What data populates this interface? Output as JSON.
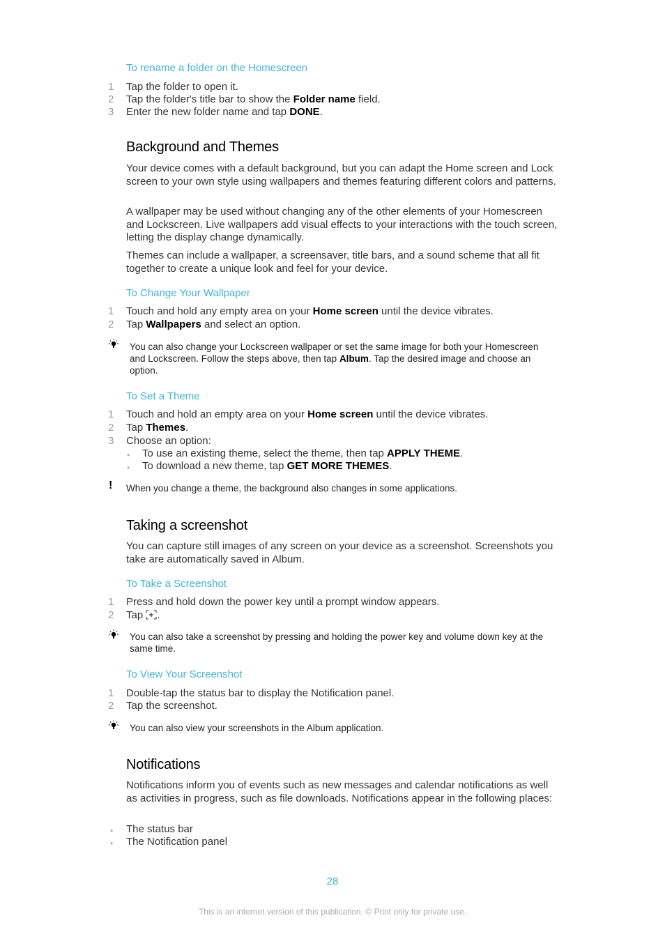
{
  "sections": {
    "rename": {
      "title": "To rename a folder on the Homescreen",
      "steps": [
        {
          "n": "1",
          "parts": [
            "Tap the folder to open it."
          ]
        },
        {
          "n": "2",
          "pre": "Tap the folder's title bar to show the ",
          "bold": "Folder name",
          "post": " field."
        },
        {
          "n": "3",
          "pre": "Enter the new folder name and tap ",
          "bold": "DONE",
          "post": "."
        }
      ]
    },
    "background": {
      "heading": "Background and Themes",
      "paras": [
        "Your device comes with a default background, but you can adapt the Home screen and Lock screen to your own style using wallpapers and themes featuring different colors and patterns.",
        "A wallpaper may be used without changing any of the other elements of your Homescreen and Lockscreen. Live wallpapers add visual effects to your interactions with the touch screen, letting the display change dynamically.",
        "Themes can include a wallpaper, a screensaver, title bars, and a sound scheme that all fit together to create a unique look and feel for your device."
      ]
    },
    "wallpaper": {
      "title": "To Change Your Wallpaper",
      "steps": [
        {
          "n": "1",
          "pre": "Touch and hold any empty area on your ",
          "bold": "Home screen",
          "post": " until the device vibrates."
        },
        {
          "n": "2",
          "pre": "Tap ",
          "bold": "Wallpapers",
          "post": " and select an option."
        }
      ],
      "tip": {
        "pre": "You can also change your Lockscreen wallpaper or set the same image for both your Homescreen and Lockscreen. Follow the steps above, then tap ",
        "bold": "Album",
        "post": ". Tap the desired image and choose an option."
      }
    },
    "theme": {
      "title": "To Set a Theme",
      "steps": [
        {
          "n": "1",
          "pre": "Touch and hold an empty area on your ",
          "bold": "Home screen",
          "post": " until the device vibrates."
        },
        {
          "n": "2",
          "pre": "Tap ",
          "bold": "Themes",
          "post": "."
        },
        {
          "n": "3",
          "pre": "Choose an option:",
          "bold": "",
          "post": ""
        }
      ],
      "bullets": [
        {
          "pre": "To use an existing theme, select the theme, then tap ",
          "bold": "APPLY THEME",
          "post": "."
        },
        {
          "pre": "To download a new theme, tap ",
          "bold": "GET MORE THEMES",
          "post": "."
        }
      ],
      "warning": "When you change a theme, the background also changes in some applications."
    },
    "screenshot": {
      "heading": "Taking a screenshot",
      "para": "You can capture still images of any screen on your device as a screenshot. Screenshots you take are automatically saved in Album.",
      "take_title": "To Take a Screenshot",
      "take_steps": [
        {
          "n": "1",
          "text": "Press and hold down the power key until a prompt window appears."
        },
        {
          "n": "2",
          "text": "Tap ",
          "icon": "screenshot-icon",
          "post": "."
        }
      ],
      "take_tip": "You can also take a screenshot by pressing and holding the power key and volume down key at the same time.",
      "view_title": "To View Your Screenshot",
      "view_steps": [
        {
          "n": "1",
          "text": "Double-tap the status bar to display the Notification panel."
        },
        {
          "n": "2",
          "text": "Tap the screenshot."
        }
      ],
      "view_tip": "You can also view your screenshots in the Album application."
    },
    "notifications": {
      "heading": "Notifications",
      "para": "Notifications inform you of events such as new messages and calendar notifications as well as activities in progress, such as file downloads. Notifications appear in the following places:",
      "bullets": [
        "The status bar",
        "The Notification panel"
      ]
    }
  },
  "footer": {
    "page_number": "28",
    "notice": "This is an internet version of this publication. © Print only for private use."
  },
  "colors": {
    "accent": "#3eb4dc"
  }
}
